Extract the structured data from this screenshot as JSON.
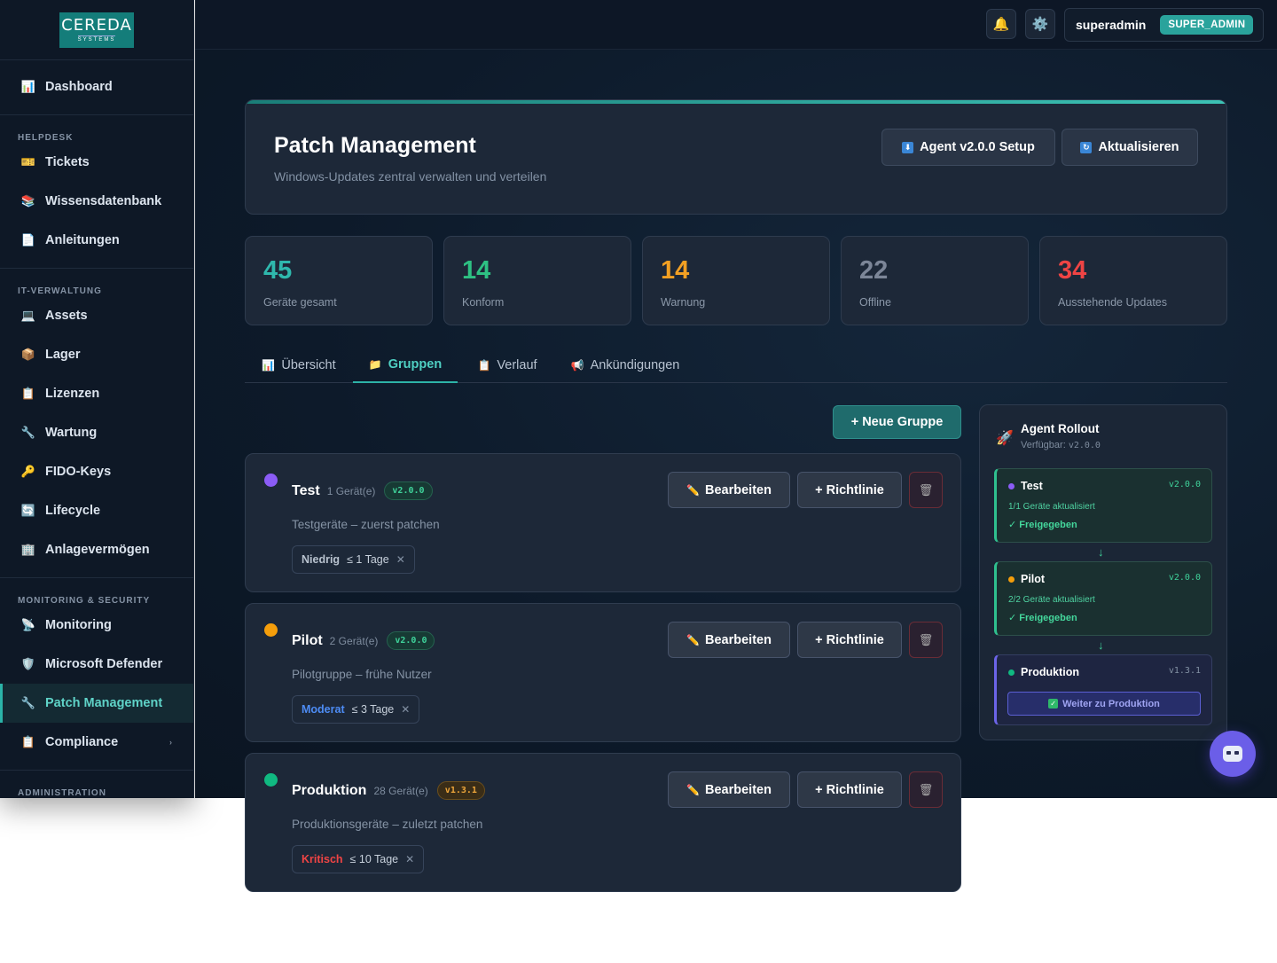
{
  "brand": {
    "logo_main": "CEREDA",
    "logo_sub": "SYSTEMS"
  },
  "sidebar": {
    "dashboard": "Dashboard",
    "sections": {
      "helpdesk": "HELPDESK",
      "it": "IT-VERWALTUNG",
      "monitoring": "MONITORING & SECURITY",
      "admin": "ADMINISTRATION"
    },
    "items": {
      "tickets": "Tickets",
      "kb": "Wissensdatenbank",
      "guides": "Anleitungen",
      "assets": "Assets",
      "lager": "Lager",
      "lizenzen": "Lizenzen",
      "wartung": "Wartung",
      "fido": "FIDO-Keys",
      "lifecycle": "Lifecycle",
      "anlage": "Anlagevermögen",
      "monitoring": "Monitoring",
      "defender": "Microsoft Defender",
      "patch": "Patch Management",
      "compliance": "Compliance"
    }
  },
  "topbar": {
    "username": "superadmin",
    "role": "SUPER_ADMIN"
  },
  "header": {
    "title": "Patch Management",
    "subtitle": "Windows-Updates zentral verwalten und verteilen",
    "agent_button": "Agent v2.0.0 Setup",
    "refresh_button": "Aktualisieren"
  },
  "stats": [
    {
      "value": "45",
      "label": "Geräte gesamt",
      "color": "#2fb8ad"
    },
    {
      "value": "14",
      "label": "Konform",
      "color": "#2ec183"
    },
    {
      "value": "14",
      "label": "Warnung",
      "color": "#f2a023"
    },
    {
      "value": "22",
      "label": "Offline",
      "color": "#7c8698"
    },
    {
      "value": "34",
      "label": "Ausstehende Updates",
      "color": "#ef4444"
    }
  ],
  "tabs": {
    "overview": "Übersicht",
    "groups": "Gruppen",
    "history": "Verlauf",
    "announcements": "Ankündigungen"
  },
  "new_group_button": "+ Neue Gruppe",
  "group_actions": {
    "edit": "Bearbeiten",
    "policy": "+ Richtlinie"
  },
  "groups": [
    {
      "name": "Test",
      "count": "1 Gerät(e)",
      "version": "v2.0.0",
      "description": "Testgeräte – zuerst patchen",
      "severity": "Niedrig",
      "days": "≤ 1 Tage",
      "dot_color": "#8b5cf6",
      "sev_color": "#b8c2ce"
    },
    {
      "name": "Pilot",
      "count": "2 Gerät(e)",
      "version": "v2.0.0",
      "description": "Pilotgruppe – frühe Nutzer",
      "severity": "Moderat",
      "days": "≤ 3 Tage",
      "dot_color": "#f59e0b",
      "sev_color": "#4d8cf5"
    },
    {
      "name": "Produktion",
      "count": "28 Gerät(e)",
      "version": "v1.3.1",
      "description": "Produktionsgeräte – zuletzt patchen",
      "severity": "Kritisch",
      "days": "≤ 10 Tage",
      "dot_color": "#10b981",
      "sev_color": "#ef4444"
    }
  ],
  "rollout": {
    "title": "Agent Rollout",
    "available_label": "Verfügbar:",
    "available_version": "v2.0.0",
    "stages": [
      {
        "name": "Test",
        "version": "v2.0.0",
        "info": "1/1 Geräte aktualisiert",
        "status": "✓ Freigegeben"
      },
      {
        "name": "Pilot",
        "version": "v2.0.0",
        "info": "2/2 Geräte aktualisiert",
        "status": "✓ Freigegeben"
      },
      {
        "name": "Produktion",
        "version": "v1.3.1",
        "action": "Weiter zu Produktion"
      }
    ]
  }
}
